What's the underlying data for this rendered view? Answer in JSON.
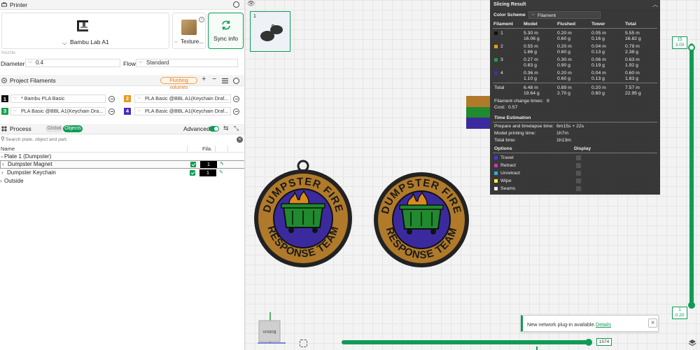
{
  "printer": {
    "section_title": "Printer",
    "printer_name": "Bambu Lab A1",
    "plate_label": "Texture...",
    "sync_label": "Sync info",
    "nozzle_label": "Nozzle",
    "diameter_label": "Diameter",
    "diameter_value": "0.4",
    "flow_label": "Flow",
    "flow_value": "Standard"
  },
  "filaments": {
    "section_title": "Project Filaments",
    "flushing_label": "Flushing volumes",
    "items": [
      {
        "num": "1",
        "color": "#111111",
        "name": "* Bambu PLA Basic"
      },
      {
        "num": "2",
        "color": "#e89a1c",
        "name": "PLA Basic @BBL A1(Keychain Draf..."
      },
      {
        "num": "3",
        "color": "#17a34a",
        "name": "PLA Basic @BBL A1(Keychain Dra..."
      },
      {
        "num": "4",
        "color": "#4b2bb5",
        "name": "PLA Basic @BBL A1(Keychain Draf..."
      }
    ]
  },
  "process": {
    "section_title": "Process",
    "tab_global": "Global",
    "tab_objects": "Objects",
    "advanced_label": "Advanced",
    "search_placeholder": "Search plate, object and part.",
    "col_name": "Name",
    "col_fila": "Fila.",
    "tree": {
      "plate": "Plate 1 (Dumpster)",
      "objects": [
        {
          "name": "Dumpster Magnet",
          "fila": "1"
        },
        {
          "name": "Dumpster Keychain",
          "fila": "1"
        }
      ],
      "outside": "Outside"
    }
  },
  "plate_thumb": {
    "number": "1"
  },
  "medallion_text": {
    "top": "DUMPSTER FIRE",
    "bottom": "RESPONSE TEAM"
  },
  "viewcube_label": "Bottom",
  "slicing": {
    "title": "Slicing Result",
    "color_scheme_label": "Color Scheme",
    "color_scheme_value": "Filament",
    "headers": [
      "Filament",
      "Model",
      "Flushed",
      "Tower",
      "Total"
    ],
    "rows": [
      {
        "id": "1",
        "color": "#111111",
        "model": [
          "5.30 m",
          "16.06 g"
        ],
        "flushed": [
          "0.20 m",
          "0.60 g"
        ],
        "tower": [
          "0.05 m",
          "0.16 g"
        ],
        "total": [
          "5.55 m",
          "16.82 g"
        ]
      },
      {
        "id": "2",
        "color": "#e89a1c",
        "model": [
          "0.55 m",
          "1.66 g"
        ],
        "flushed": [
          "0.20 m",
          "0.60 g"
        ],
        "tower": [
          "0.04 m",
          "0.13 g"
        ],
        "total": [
          "0.79 m",
          "2.38 g"
        ]
      },
      {
        "id": "3",
        "color": "#17a34a",
        "model": [
          "0.27 m",
          "0.83 g"
        ],
        "flushed": [
          "0.30 m",
          "0.90 g"
        ],
        "tower": [
          "0.06 m",
          "0.19 g"
        ],
        "total": [
          "0.63 m",
          "1.92 g"
        ]
      },
      {
        "id": "4",
        "color": "#4b2bb5",
        "model": [
          "0.36 m",
          "1.10 g"
        ],
        "flushed": [
          "0.20 m",
          "0.60 g"
        ],
        "tower": [
          "0.04 m",
          "0.13 g"
        ],
        "total": [
          "0.60 m",
          "1.83 g"
        ]
      }
    ],
    "total_row": {
      "label": "Total",
      "model": [
        "6.48 m",
        "19.64 g"
      ],
      "flushed": [
        "0.89 m",
        "2.70 g"
      ],
      "tower": [
        "0.20 m",
        "0.60 g"
      ],
      "total": [
        "7.57 m",
        "22.95 g"
      ]
    },
    "change_times_label": "Filament change times:",
    "change_times_value": "9",
    "cost_label": "Cost:",
    "cost_value": "0.57",
    "time_title": "Time Estimation",
    "prepare_label": "Prepare and timelapse time:",
    "prepare_value": "6m15s + 22s",
    "model_time_label": "Model printing time:",
    "model_time_value": "1h7m",
    "total_time_label": "Total time:",
    "total_time_value": "1h13m",
    "options_label": "Options",
    "display_label": "Display",
    "options": [
      {
        "name": "Travel",
        "color": "#3f3fd6"
      },
      {
        "name": "Retract",
        "color": "#cc33cc"
      },
      {
        "name": "Unretract",
        "color": "#33aadd"
      },
      {
        "name": "Wipe",
        "color": "#ffee33"
      },
      {
        "name": "Seams",
        "color": "#eeeeee"
      }
    ]
  },
  "layer_slider": {
    "top_layer": "15",
    "top_height": "3.00",
    "bottom_layer": "1",
    "bottom_height": "0.20"
  },
  "move_slider": {
    "value": "1574"
  },
  "notification": {
    "message": "New network plug-in available.",
    "link": "Details"
  }
}
